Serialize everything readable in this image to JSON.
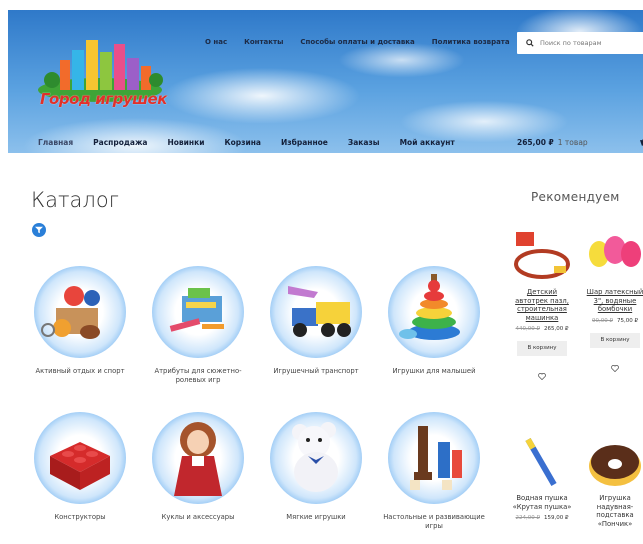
{
  "header": {
    "top_links": [
      "О нас",
      "Контакты",
      "Способы оплаты и доставка",
      "Политика возврата"
    ],
    "search_placeholder": "Поиск по товарам",
    "logo_text": "Город игрушек",
    "main_nav": [
      "Главная",
      "Распродажа",
      "Новинки",
      "Корзина",
      "Избранное",
      "Заказы",
      "Мой аккаунт"
    ],
    "cart_total": "265,00 ₽",
    "cart_count": "1 товар"
  },
  "catalog": {
    "title": "Каталог",
    "categories": [
      {
        "label": "Активный отдых и спорт",
        "icon": "sports-equipment"
      },
      {
        "label": "Атрибуты для сюжетно-ролевых игр",
        "icon": "cash-register-toy"
      },
      {
        "label": "Игрушечный транспорт",
        "icon": "toy-truck"
      },
      {
        "label": "Игрушки для малышей",
        "icon": "stacking-rings"
      },
      {
        "label": "Конструкторы",
        "icon": "lego-brick"
      },
      {
        "label": "Куклы и аксессуары",
        "icon": "doll"
      },
      {
        "label": "Мягкие игрушки",
        "icon": "teddy-bear"
      },
      {
        "label": "Настольные и развивающие игры",
        "icon": "board-game-pieces"
      }
    ]
  },
  "recommended": {
    "title": "Рекомендуем",
    "items": [
      {
        "name": "Детский автотрек пазл, строительная машинка",
        "old_price": "440,00 ₽",
        "price": "265,00 ₽",
        "button": "В корзину"
      },
      {
        "name": "Шар латексный 3\", водяные бомбочки",
        "old_price": "90,00 ₽",
        "price": "75,00 ₽",
        "button": "В корзину"
      },
      {
        "name": "Водная пушка «Крутая пушка»",
        "old_price": "224,00 ₽",
        "price": "159,00 ₽"
      },
      {
        "name": "Игрушка надувная-подставка «Пончик»"
      }
    ]
  }
}
